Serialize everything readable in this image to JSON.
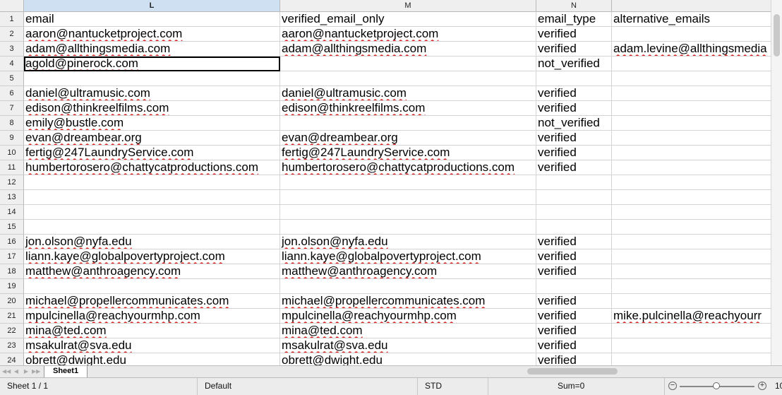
{
  "columns": [
    {
      "letter": "L",
      "active": true
    },
    {
      "letter": "M",
      "active": false
    },
    {
      "letter": "N",
      "active": false
    },
    {
      "letter": "",
      "active": false
    }
  ],
  "rows": [
    {
      "num": "1",
      "cells": [
        "email",
        "verified_email_only",
        "email_type",
        "alternative_emails"
      ]
    },
    {
      "num": "2",
      "cells": [
        "aaron@nantucketproject.com",
        "aaron@nantucketproject.com",
        "verified",
        ""
      ]
    },
    {
      "num": "3",
      "cells": [
        "adam@allthingsmedia.com",
        "adam@allthingsmedia.com",
        "verified",
        "adam.levine@allthingsmedia"
      ]
    },
    {
      "num": "4",
      "cells": [
        "agold@pinerock.com",
        "",
        "not_verified",
        ""
      ]
    },
    {
      "num": "5",
      "cells": [
        "",
        "",
        "",
        ""
      ]
    },
    {
      "num": "6",
      "cells": [
        "daniel@ultramusic.com",
        "daniel@ultramusic.com",
        "verified",
        ""
      ]
    },
    {
      "num": "7",
      "cells": [
        "edison@thinkreelfilms.com",
        "edison@thinkreelfilms.com",
        "verified",
        ""
      ]
    },
    {
      "num": "8",
      "cells": [
        "emily@bustle.com",
        "",
        "not_verified",
        ""
      ]
    },
    {
      "num": "9",
      "cells": [
        "evan@dreambear.org",
        "evan@dreambear.org",
        "verified",
        ""
      ]
    },
    {
      "num": "10",
      "cells": [
        "fertig@247LaundryService.com",
        "fertig@247LaundryService.com",
        "verified",
        ""
      ]
    },
    {
      "num": "11",
      "cells": [
        "humbertorosero@chattycatproductions.com",
        "humbertorosero@chattycatproductions.com",
        "verified",
        ""
      ]
    },
    {
      "num": "12",
      "cells": [
        "",
        "",
        "",
        ""
      ]
    },
    {
      "num": "13",
      "cells": [
        "",
        "",
        "",
        ""
      ]
    },
    {
      "num": "14",
      "cells": [
        "",
        "",
        "",
        ""
      ]
    },
    {
      "num": "15",
      "cells": [
        "",
        "",
        "",
        ""
      ]
    },
    {
      "num": "16",
      "cells": [
        "jon.olson@nyfa.edu",
        "jon.olson@nyfa.edu",
        "verified",
        ""
      ]
    },
    {
      "num": "17",
      "cells": [
        "liann.kaye@globalpovertyproject.com",
        "liann.kaye@globalpovertyproject.com",
        "verified",
        ""
      ]
    },
    {
      "num": "18",
      "cells": [
        "matthew@anthroagency.com",
        "matthew@anthroagency.com",
        "verified",
        ""
      ]
    },
    {
      "num": "19",
      "cells": [
        "",
        "",
        "",
        ""
      ]
    },
    {
      "num": "20",
      "cells": [
        "michael@propellercommunicates.com",
        "michael@propellercommunicates.com",
        "verified",
        ""
      ]
    },
    {
      "num": "21",
      "cells": [
        "mpulcinella@reachyourmhp.com",
        "mpulcinella@reachyourmhp.com",
        "verified",
        "mike.pulcinella@reachyourr"
      ]
    },
    {
      "num": "22",
      "cells": [
        "mina@ted.com",
        "mina@ted.com",
        "verified",
        ""
      ]
    },
    {
      "num": "23",
      "cells": [
        "msakulrat@sva.edu",
        "msakulrat@sva.edu",
        "verified",
        ""
      ]
    },
    {
      "num": "24",
      "cells": [
        "obrett@dwight.edu",
        "obrett@dwight.edu",
        "verified",
        ""
      ]
    }
  ],
  "selected_cell": "L4",
  "sheet_tab": "Sheet1",
  "statusbar": {
    "sheet": "Sheet 1 / 1",
    "style": "Default",
    "mode": "STD",
    "sum": "Sum=0",
    "zoom": "10"
  },
  "icons": {
    "nav_first": "first-sheet-icon",
    "nav_prev": "prev-sheet-icon",
    "nav_next": "next-sheet-icon",
    "nav_last": "last-sheet-icon",
    "zoom_out": "zoom-out-icon",
    "zoom_in": "zoom-in-icon"
  }
}
